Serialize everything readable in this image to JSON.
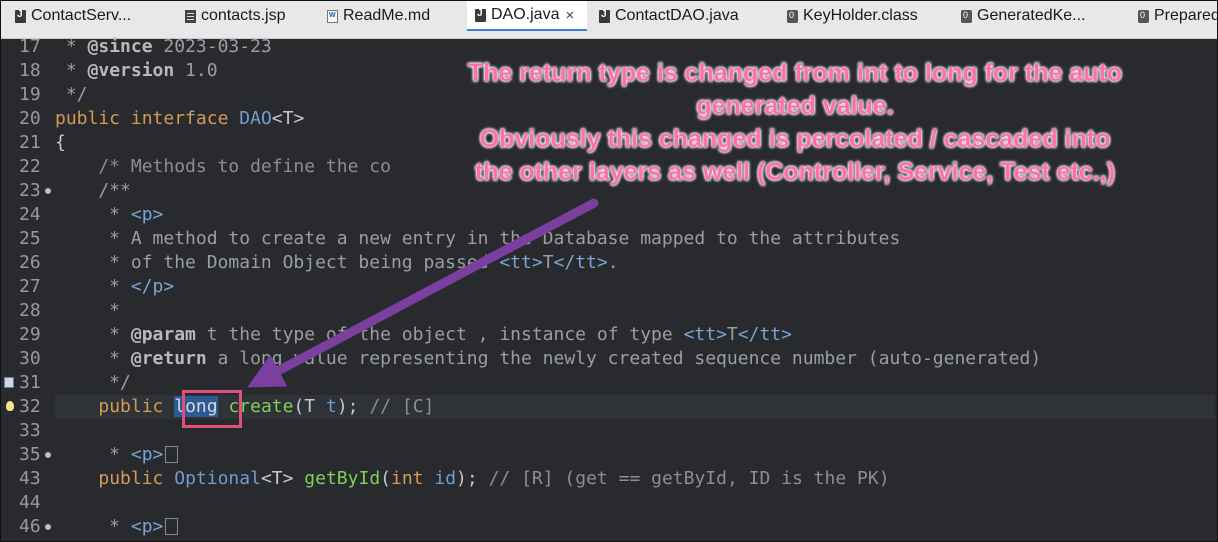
{
  "tabs": [
    {
      "label": "ContactServ...",
      "icon": "java-file-icon",
      "active": false
    },
    {
      "label": "contacts.jsp",
      "icon": "jsp-file-icon",
      "active": false
    },
    {
      "label": "ReadMe.md",
      "icon": "markdown-file-icon",
      "active": false
    },
    {
      "label": "DAO.java",
      "icon": "java-file-icon",
      "active": true,
      "close": "×"
    },
    {
      "label": "ContactDAO.java",
      "icon": "java-file-icon",
      "active": false
    },
    {
      "label": "KeyHolder.class",
      "icon": "class-file-icon",
      "active": false
    },
    {
      "label": "GeneratedKe...",
      "icon": "class-file-icon",
      "active": false
    },
    {
      "label": "Prepared",
      "icon": "class-file-icon",
      "active": false
    }
  ],
  "lines": [
    {
      "n": "17",
      "spans": [
        [
          "jd",
          " * "
        ],
        [
          "jdk",
          "@since"
        ],
        [
          "jd",
          " 2023-03-23"
        ]
      ]
    },
    {
      "n": "18",
      "spans": [
        [
          "jd",
          " * "
        ],
        [
          "jdk",
          "@version"
        ],
        [
          "jd",
          " 1.0"
        ]
      ]
    },
    {
      "n": "19",
      "spans": [
        [
          "jd",
          " */"
        ]
      ]
    },
    {
      "n": "20",
      "spans": [
        [
          "kw",
          "public"
        ],
        [
          "",
          " "
        ],
        [
          "kw",
          "interface"
        ],
        [
          "",
          " "
        ],
        [
          "ty",
          "DAO"
        ],
        [
          "",
          "<T>"
        ]
      ]
    },
    {
      "n": "21",
      "spans": [
        [
          "",
          "{"
        ]
      ]
    },
    {
      "n": "22",
      "spans": [
        [
          "cm",
          "    /* Methods to define the co"
        ]
      ]
    },
    {
      "n": "23",
      "mark": true,
      "spans": [
        [
          "jd",
          "    /**"
        ]
      ]
    },
    {
      "n": "24",
      "spans": [
        [
          "jd",
          "     * "
        ],
        [
          "tag",
          "<p>"
        ]
      ]
    },
    {
      "n": "25",
      "spans": [
        [
          "jd",
          "     * A method to create a new entry in the Database mapped to the attributes"
        ]
      ]
    },
    {
      "n": "26",
      "spans": [
        [
          "jd",
          "     * of the Domain Object being passed "
        ],
        [
          "tag",
          "<tt>"
        ],
        [
          "jd",
          "T"
        ],
        [
          "tag",
          "</tt>"
        ],
        [
          "jd",
          "."
        ]
      ]
    },
    {
      "n": "27",
      "spans": [
        [
          "jd",
          "     * "
        ],
        [
          "tag",
          "</p>"
        ]
      ]
    },
    {
      "n": "28",
      "spans": [
        [
          "jd",
          "     *"
        ]
      ]
    },
    {
      "n": "29",
      "spans": [
        [
          "jd",
          "     * "
        ],
        [
          "jdk",
          "@param"
        ],
        [
          "jd",
          " t the type of the object , instance of type "
        ],
        [
          "tag",
          "<tt>"
        ],
        [
          "jd",
          "T"
        ],
        [
          "tag",
          "</tt>"
        ]
      ]
    },
    {
      "n": "30",
      "spans": [
        [
          "jd",
          "     * "
        ],
        [
          "jdk",
          "@return"
        ],
        [
          "jd",
          " a long value representing the newly created sequence number (auto-generated)"
        ]
      ]
    },
    {
      "n": "31",
      "spans": [
        [
          "jd",
          "     */"
        ]
      ]
    },
    {
      "n": "32",
      "current": true,
      "spans": [
        [
          "",
          "    "
        ],
        [
          "kw",
          "public"
        ],
        [
          "",
          " "
        ],
        [
          "kwsel",
          "long"
        ],
        [
          "",
          " "
        ],
        [
          "fn",
          "create"
        ],
        [
          "",
          "(T "
        ],
        [
          "ty",
          "t"
        ],
        [
          "",
          "); "
        ],
        [
          "cm",
          "// [C]"
        ]
      ]
    },
    {
      "n": "33",
      "spans": []
    },
    {
      "n": "35",
      "mark": true,
      "spans": [
        [
          "jd",
          "     * "
        ],
        [
          "tag",
          "<p>"
        ],
        [
          "fold",
          ""
        ]
      ]
    },
    {
      "n": "43",
      "spans": [
        [
          "",
          "    "
        ],
        [
          "kw",
          "public"
        ],
        [
          "",
          " "
        ],
        [
          "ty",
          "Optional"
        ],
        [
          "",
          "<T> "
        ],
        [
          "fn",
          "getById"
        ],
        [
          "",
          "("
        ],
        [
          "kw",
          "int"
        ],
        [
          "",
          " "
        ],
        [
          "ty",
          "id"
        ],
        [
          "",
          "); "
        ],
        [
          "cm",
          "// [R] (get == getById, ID is the PK)"
        ]
      ]
    },
    {
      "n": "44",
      "spans": []
    },
    {
      "n": "46",
      "mark": true,
      "spans": [
        [
          "jd",
          "     * "
        ],
        [
          "tag",
          "<p>"
        ],
        [
          "fold",
          ""
        ]
      ]
    }
  ],
  "callout": {
    "line1": "The return type is changed from int to long for the auto",
    "line2": "generated value.",
    "line3": "Obviously this changed is percolated / cascaded into",
    "line4": "the other layers as well (Controller, Service, Test etc.,)"
  },
  "colors": {
    "annotation": "#ff6fa8",
    "arrow": "#7b3fa0",
    "highlight_box": "#e0507d",
    "selection": "#2c5a93"
  }
}
